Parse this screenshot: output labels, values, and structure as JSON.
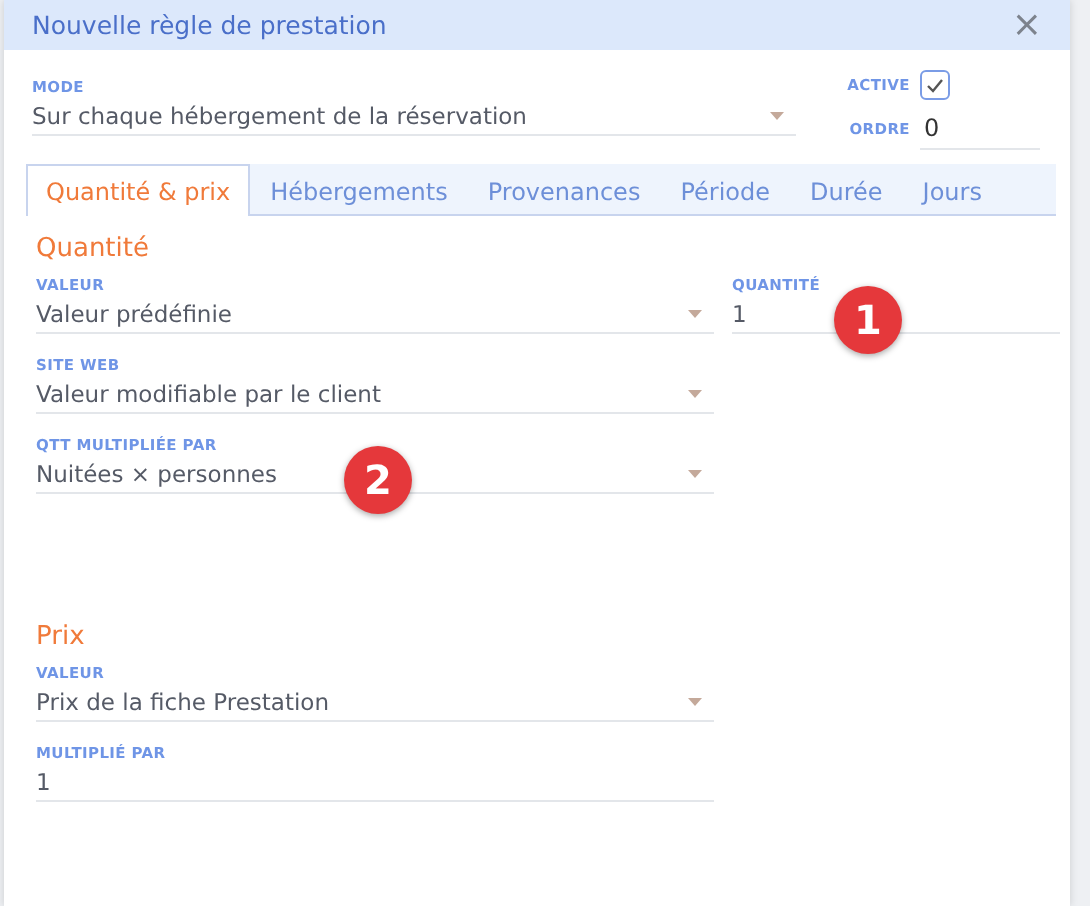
{
  "window": {
    "title": "Nouvelle règle de prestation",
    "close": "×"
  },
  "header": {
    "mode": {
      "label": "MODE",
      "value": "Sur chaque hébergement de la réservation"
    },
    "active": {
      "label": "ACTIVE",
      "checked": true
    },
    "order": {
      "label": "ORDRE",
      "value": "0"
    }
  },
  "tabs": [
    {
      "label": "Quantité & prix",
      "selected": true
    },
    {
      "label": "Hébergements",
      "selected": false
    },
    {
      "label": "Provenances",
      "selected": false
    },
    {
      "label": "Période",
      "selected": false
    },
    {
      "label": "Durée",
      "selected": false
    },
    {
      "label": "Jours",
      "selected": false
    }
  ],
  "sections": [
    {
      "title": "Quantité",
      "fields": [
        {
          "kind": "select",
          "label": "VALEUR",
          "value": "Valeur prédéfinie",
          "side": {
            "label": "QUANTITÉ",
            "value": "1",
            "badge": "1"
          }
        },
        {
          "kind": "select",
          "label": "SITE WEB",
          "value": "Valeur modifiable par le client"
        },
        {
          "kind": "select",
          "label": "QTT MULTIPLIÉE PAR",
          "value": "Nuitées × personnes",
          "badge": "2"
        }
      ]
    },
    {
      "title": "Prix",
      "fields": [
        {
          "kind": "select",
          "label": "VALEUR",
          "value": "Prix de la fiche Prestation"
        },
        {
          "kind": "input",
          "label": "MULTIPLIÉ PAR",
          "value": "1"
        }
      ]
    }
  ]
}
